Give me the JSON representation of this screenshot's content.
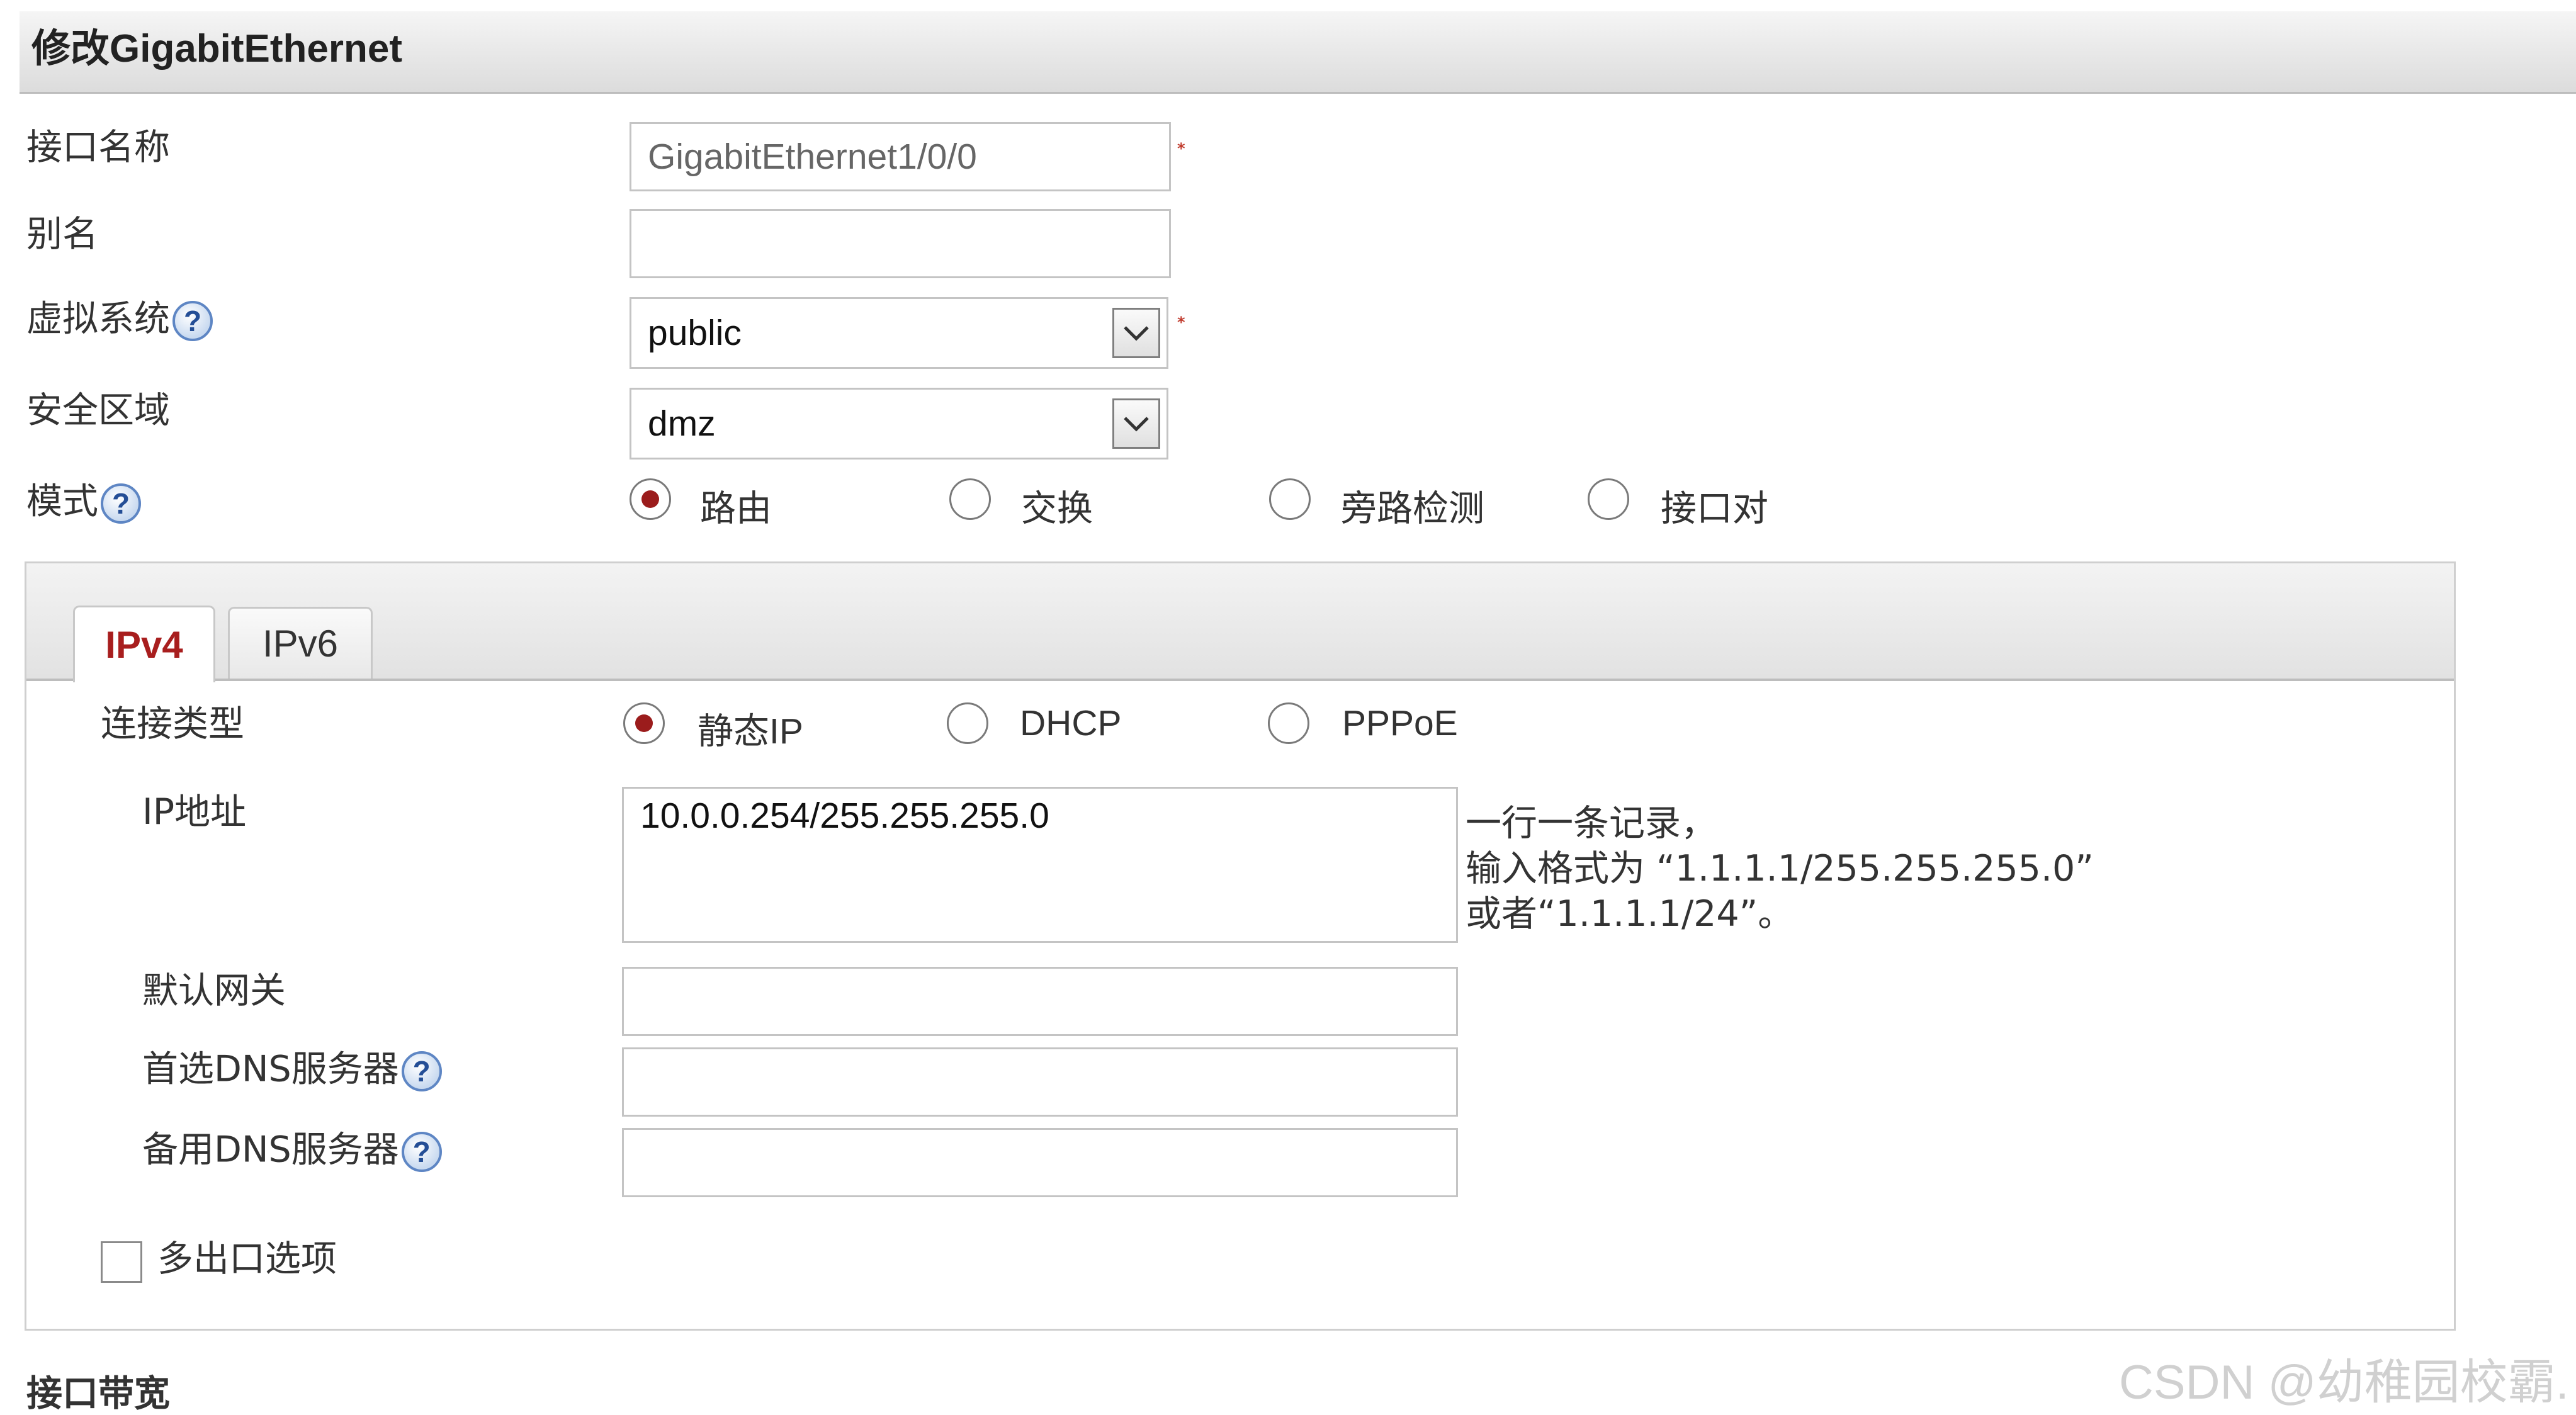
{
  "header": {
    "title": "修改GigabitEthernet"
  },
  "form": {
    "interface_name": {
      "label": "接口名称",
      "value": "GigabitEthernet1/0/0",
      "required_mark": "*"
    },
    "alias": {
      "label": "别名",
      "value": ""
    },
    "virtual_system": {
      "label": "虚拟系统",
      "help_glyph": "?",
      "value": "public",
      "required_mark": "*"
    },
    "security_zone": {
      "label": "安全区域",
      "value": "dmz"
    },
    "mode": {
      "label": "模式",
      "help_glyph": "?",
      "options": [
        {
          "label": "路由",
          "selected": true
        },
        {
          "label": "交换",
          "selected": false
        },
        {
          "label": "旁路检测",
          "selected": false
        },
        {
          "label": "接口对",
          "selected": false
        }
      ]
    }
  },
  "ip_panel": {
    "tabs": [
      {
        "label": "IPv4",
        "active": true
      },
      {
        "label": "IPv6",
        "active": false
      }
    ],
    "connection_type": {
      "label": "连接类型",
      "options": [
        {
          "label": "静态IP",
          "selected": true
        },
        {
          "label": "DHCP",
          "selected": false
        },
        {
          "label": "PPPoE",
          "selected": false
        }
      ]
    },
    "ip_address": {
      "label": "IP地址",
      "value": "10.0.0.254/255.255.255.0",
      "hint": [
        "一行一条记录，",
        "输入格式为 “1.1.1.1/255.255.255.0”",
        "或者“1.1.1.1/24”。"
      ]
    },
    "default_gateway": {
      "label": "默认网关",
      "value": ""
    },
    "primary_dns": {
      "label": "首选DNS服务器",
      "help_glyph": "?",
      "value": ""
    },
    "backup_dns": {
      "label": "备用DNS服务器",
      "help_glyph": "?",
      "value": ""
    },
    "multi_egress": {
      "label": "多出口选项",
      "checked": false
    }
  },
  "bandwidth_section": {
    "label": "接口带宽"
  },
  "watermark": {
    "text": "CSDN @幼稚园校霸."
  },
  "colors": {
    "accent": "#a81e1e",
    "radio_dot": "#9b1c1c",
    "help_ring": "#5e86c4",
    "required": "#c0392b"
  }
}
